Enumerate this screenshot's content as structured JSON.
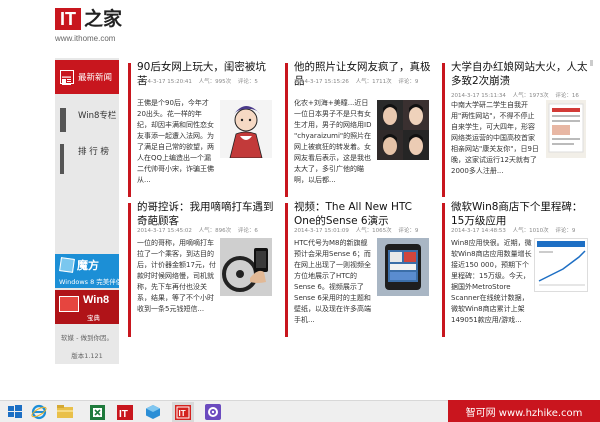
{
  "header": {
    "logo_mark": "IT",
    "logo_cn": "之家",
    "logo_url": "www.ithome.com"
  },
  "nav": {
    "items": [
      {
        "label": "最新新闻",
        "icon": "newspaper-icon",
        "active": true
      },
      {
        "label": "Win8专栏",
        "icon": "windows-icon",
        "active": false
      },
      {
        "label": "排 行 榜",
        "icon": "bar-chart-icon",
        "active": false
      }
    ],
    "promo_cube": {
      "big": "魔方",
      "small": "Windows 8 完美伴侣"
    },
    "promo_win8": {
      "big": "Win8",
      "small": "宝典"
    },
    "footer": "软媒 - 做到你因。",
    "version": "版本1.121"
  },
  "articles": [
    {
      "title": "90后女网上玩大，闺密被坑苦",
      "date": "2014-3-17 15:20:41",
      "views": "人气：995次",
      "comments": "评论：5",
      "excerpt": "王佛是个90后，今年才20出头。花一样的年纪，却因丰满和同性恋女友事添一起遭入法网。为了满足自己常的欲望，两人在QQ上编造出一个漏二代帅哥小宋，诈骗王佛从..."
    },
    {
      "title": "他的照片让女网友疯了，真极品",
      "date": "2014-3-17 15:15:26",
      "views": "人气：1711次",
      "comments": "评论：9",
      "excerpt": "化农+刘海+美瞳...近日一位日本男子不是只有女生才用，男子的网络用ID \"chyaraizumi\"的照片在网上被疯狂的转发着。女网友看后表示，这是我也太大了，多引广他的瞄啊，以后都..."
    },
    {
      "title": "大学自办红娘网站大火，人太多致2次崩溃",
      "date": "2014-3-17 15:11:34",
      "views": "人气：1973次",
      "comments": "评论：16",
      "excerpt": "中南大学研二学生自我开用\"两性网站\"，不得不停止自来学生，可大四年，形容网络类运营的中国高校首家相亲网站\"康关友你\"，日9日晚，这家试运行12天就有了2000多人注册..."
    },
    {
      "title": "的哥控诉：我用嘀嘀打车遇到奇葩顾客",
      "date": "2014-3-17 15:45:02",
      "views": "人气：896次",
      "comments": "评论：6",
      "excerpt": "一位的哥称，用嘀嘀打车拉了一个乘客，到达目的后，计价器金额17元，付款时时候网络慢，司机就称，先下车再付也没关系，结果，等了不个小时收到一条5元钱短信..."
    },
    {
      "title": "视频：The All New HTC One的Sense 6演示",
      "date": "2014-3-17 15:01:09",
      "views": "人气：1065次",
      "comments": "评论：9",
      "excerpt": "HTC代号为M8的新旗舰预计会采用Sense 6；而在网上出现了一则视频全方位地展示了HTC的Sense 6。视频展示了Sense 6采用时的主题和壁纸，以及现在许多高端手机..."
    },
    {
      "title": "微软Win8商店下个里程碑：15万级应用",
      "date": "2014-3-17 14:48:53",
      "views": "人气：1010次",
      "comments": "评论：9",
      "excerpt": "Win8应用快很。近期，微软Win8商店应用数量增长接近150 000，预期下个里程碑：15万级。今天，据国外MetroStore Scanner在线统计数据，微软Win8商店累计上架149051款应用/游戏..."
    }
  ],
  "taskbar": {
    "icons": [
      "windows-start-icon",
      "internet-explorer-icon",
      "file-explorer-icon",
      "excel-icon",
      "ithome-icon",
      "cube-app-icon",
      "ithome-red-icon",
      "settings-icon"
    ]
  },
  "watermark": "智可网 www.hzhike.com",
  "colors": {
    "accent": "#c8161e",
    "nav_bg": "#e8e8e8",
    "cube_blue": "#1c8fd6"
  }
}
